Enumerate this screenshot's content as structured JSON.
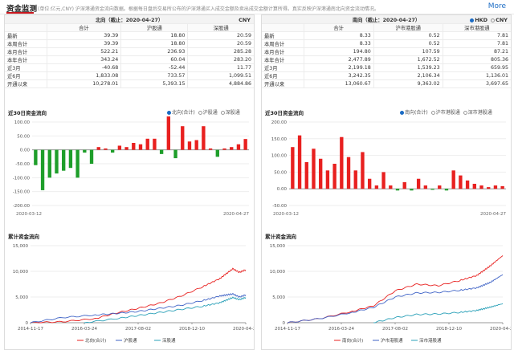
{
  "header": {
    "title": "资金监测",
    "note": "(单位:亿元,CNY)  沪深港通资金流向数据。根据每日盘后交易所公布的沪深港通买入成交金额及卖出成交金额计算所得。真实反映沪深港通南北向资金流动情况。",
    "more": "More"
  },
  "left": {
    "table": {
      "title": "北向（截止：2020-04-27）",
      "currency": "CNY",
      "cols": [
        "合计",
        "沪股通",
        "深股通"
      ],
      "rows": [
        [
          "最新",
          "39.39",
          "18.80",
          "20.59"
        ],
        [
          "本周合计",
          "39.39",
          "18.80",
          "20.59"
        ],
        [
          "本月合计",
          "522.21",
          "236.93",
          "285.28"
        ],
        [
          "本年合计",
          "343.24",
          "60.04",
          "283.20"
        ],
        [
          "近3月",
          "-40.68",
          "-52.44",
          "11.77"
        ],
        [
          "近6月",
          "1,833.08",
          "733.57",
          "1,099.51"
        ],
        [
          "开通以来",
          "10,278.01",
          "5,393.15",
          "4,884.86"
        ]
      ]
    },
    "flow_title": "近30日资金流向",
    "flow_options": [
      "北向(合计)",
      "沪股通",
      "深股通"
    ],
    "cum_title": "累计资金流向"
  },
  "right": {
    "table": {
      "title": "南向（截止：2020-04-27）",
      "currency_options": [
        "HKD",
        "CNY"
      ],
      "cols": [
        "合计",
        "沪市港股通",
        "深市港股通"
      ],
      "rows": [
        [
          "最新",
          "8.33",
          "0.52",
          "7.81"
        ],
        [
          "本周合计",
          "8.33",
          "0.52",
          "7.81"
        ],
        [
          "本月合计",
          "194.80",
          "107.59",
          "87.21"
        ],
        [
          "本年合计",
          "2,477.89",
          "1,672.52",
          "805.36"
        ],
        [
          "近3月",
          "2,199.18",
          "1,539.23",
          "659.95"
        ],
        [
          "近6月",
          "3,242.35",
          "2,106.34",
          "1,136.01"
        ],
        [
          "开通以来",
          "13,060.67",
          "9,363.02",
          "3,697.65"
        ]
      ]
    },
    "flow_title": "近30日资金流向",
    "flow_options": [
      "南向(合计)",
      "沪市港股通",
      "深市港股通"
    ],
    "cum_title": "累计资金流向"
  },
  "colors": {
    "up": "#e8201f",
    "down": "#1e9e2a",
    "s1": "#e8201f",
    "s2": "#3f63c6",
    "s3": "#2aa0b8",
    "accent": "#c8161d",
    "link": "#1a6bc4"
  },
  "chart_data": [
    {
      "type": "bar",
      "title": "近30日资金流向",
      "x_start": "2020-03-12",
      "x_end": "2020-04-27",
      "ylim": [
        -200,
        100
      ],
      "ticks": [
        "100.00",
        "50.00",
        "0.00",
        "-50.00",
        "-100.00",
        "-150.00",
        "-200.00"
      ],
      "series": [
        {
          "name": "北向(合计)",
          "values": [
            -55,
            -145,
            -100,
            -85,
            -75,
            -65,
            -100,
            -10,
            -50,
            10,
            5,
            -10,
            15,
            10,
            25,
            20,
            40,
            40,
            -15,
            120,
            -30,
            85,
            30,
            35,
            85,
            5,
            -25,
            5,
            10,
            20,
            39
          ]
        }
      ]
    },
    {
      "type": "bar",
      "title": "近30日资金流向",
      "x_start": "2020-03-12",
      "x_end": "2020-04-27",
      "ylim": [
        -50,
        200
      ],
      "ticks": [
        "200.00",
        "150.00",
        "100.00",
        "50.00",
        "0.00",
        "-50.00"
      ],
      "series": [
        {
          "name": "南向(合计)",
          "values": [
            125,
            160,
            80,
            120,
            90,
            55,
            75,
            155,
            95,
            55,
            110,
            30,
            10,
            50,
            10,
            -5,
            20,
            -5,
            30,
            10,
            -3,
            10,
            -5,
            55,
            40,
            25,
            15,
            10,
            5,
            10,
            8
          ]
        }
      ]
    },
    {
      "type": "line",
      "title": "累计资金流向",
      "x_ticks": [
        "2014-11-17",
        "2016-03-24",
        "2017-08-02",
        "2018-12-10",
        "2020-04-22"
      ],
      "ylim": [
        0,
        15000
      ],
      "ticks": [
        "15,000",
        "10,000",
        "5,000",
        "0"
      ],
      "series": [
        {
          "name": "北向(合计)",
          "anchors": [
            [
              0,
              0
            ],
            [
              0.15,
              200
            ],
            [
              0.3,
              800
            ],
            [
              0.4,
              1900
            ],
            [
              0.5,
              2800
            ],
            [
              0.6,
              3800
            ],
            [
              0.7,
              5200
            ],
            [
              0.8,
              7000
            ],
            [
              0.88,
              8600
            ],
            [
              0.94,
              10500
            ],
            [
              0.97,
              9800
            ],
            [
              1,
              10300
            ]
          ]
        },
        {
          "name": "沪股通",
          "anchors": [
            [
              0,
              0
            ],
            [
              0.15,
              1000
            ],
            [
              0.3,
              1500
            ],
            [
              0.4,
              1800
            ],
            [
              0.5,
              2200
            ],
            [
              0.6,
              2800
            ],
            [
              0.7,
              3400
            ],
            [
              0.8,
              4300
            ],
            [
              0.88,
              5200
            ],
            [
              0.94,
              5600
            ],
            [
              0.97,
              5000
            ],
            [
              1,
              5400
            ]
          ]
        },
        {
          "name": "深股通",
          "anchors": [
            [
              0.25,
              0
            ],
            [
              0.4,
              800
            ],
            [
              0.5,
              1400
            ],
            [
              0.6,
              2000
            ],
            [
              0.7,
              2600
            ],
            [
              0.8,
              3200
            ],
            [
              0.88,
              3900
            ],
            [
              0.94,
              4900
            ],
            [
              0.97,
              4500
            ],
            [
              1,
              4900
            ]
          ]
        }
      ]
    },
    {
      "type": "line",
      "title": "累计资金流向",
      "x_ticks": [
        "2014-11-17",
        "2016-03-24",
        "2017-08-02",
        "2018-12-10",
        "2020-04-22"
      ],
      "ylim": [
        0,
        15000
      ],
      "ticks": [
        "15,000",
        "10,000",
        "5,000",
        "0"
      ],
      "series": [
        {
          "name": "南向(合计)",
          "anchors": [
            [
              0,
              0
            ],
            [
              0.15,
              800
            ],
            [
              0.3,
              2200
            ],
            [
              0.4,
              3300
            ],
            [
              0.5,
              6200
            ],
            [
              0.6,
              7500
            ],
            [
              0.7,
              7200
            ],
            [
              0.8,
              8200
            ],
            [
              0.88,
              9200
            ],
            [
              0.94,
              11000
            ],
            [
              1,
              13060
            ]
          ]
        },
        {
          "name": "沪市港股通",
          "anchors": [
            [
              0,
              0
            ],
            [
              0.15,
              800
            ],
            [
              0.3,
              2000
            ],
            [
              0.4,
              3000
            ],
            [
              0.5,
              5000
            ],
            [
              0.6,
              5800
            ],
            [
              0.7,
              5900
            ],
            [
              0.8,
              6300
            ],
            [
              0.88,
              6800
            ],
            [
              0.94,
              7800
            ],
            [
              1,
              9360
            ]
          ]
        },
        {
          "name": "深市港股通",
          "anchors": [
            [
              0.4,
              0
            ],
            [
              0.5,
              1000
            ],
            [
              0.6,
              1600
            ],
            [
              0.7,
              1700
            ],
            [
              0.8,
              2000
            ],
            [
              0.88,
              2400
            ],
            [
              0.94,
              3000
            ],
            [
              1,
              3700
            ]
          ]
        }
      ]
    }
  ]
}
